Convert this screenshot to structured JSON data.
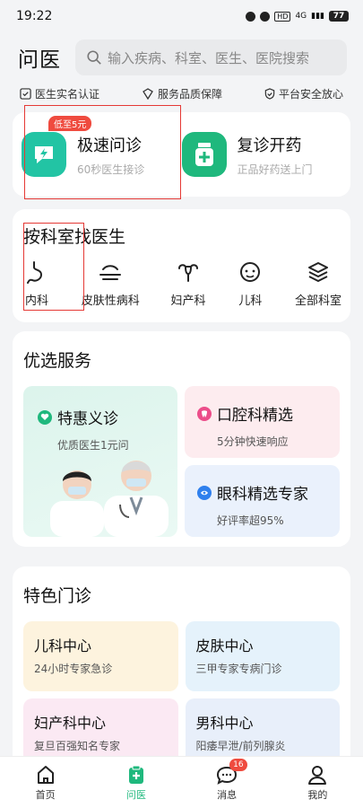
{
  "status_bar": {
    "time": "19:22",
    "network": "4G",
    "battery": "77"
  },
  "header": {
    "title": "问医",
    "search_placeholder": "输入疾病、科室、医生、医院搜索"
  },
  "badges": [
    "医生实名认证",
    "服务品质保障",
    "平台安全放心"
  ],
  "quick": [
    {
      "title": "极速问诊",
      "subtitle": "60秒医生接诊",
      "tag": "低至5元",
      "icon": "lightning-chat-icon",
      "color": "#22c4a4"
    },
    {
      "title": "复诊开药",
      "subtitle": "正品好药送上门",
      "icon": "medicine-bottle-icon",
      "color": "#1fb87d"
    }
  ],
  "departments": {
    "title": "按科室找医生",
    "items": [
      {
        "label": "内科",
        "icon": "stomach-icon"
      },
      {
        "label": "皮肤性病科",
        "icon": "skin-icon"
      },
      {
        "label": "妇产科",
        "icon": "uterus-icon"
      },
      {
        "label": "儿科",
        "icon": "baby-face-icon"
      },
      {
        "label": "全部科室",
        "icon": "layers-icon"
      }
    ]
  },
  "services": {
    "title": "优选服务",
    "big": {
      "title": "特惠义诊",
      "subtitle": "优质医生1元问",
      "icon": "heart-icon"
    },
    "small": [
      {
        "title": "口腔科精选",
        "subtitle": "5分钟快速响应",
        "icon": "tooth-icon",
        "color": "#ec4d8a"
      },
      {
        "title": "眼科精选专家",
        "subtitle": "好评率超95%",
        "icon": "eye-icon",
        "color": "#2f80ed"
      }
    ]
  },
  "special": {
    "title": "特色门诊",
    "items": [
      {
        "title": "儿科中心",
        "subtitle": "24小时专家急诊"
      },
      {
        "title": "皮肤中心",
        "subtitle": "三甲专家专病门诊"
      },
      {
        "title": "妇产科中心",
        "subtitle": "复旦百强知名专家"
      },
      {
        "title": "男科中心",
        "subtitle": "阳痿早泄/前列腺炎"
      }
    ]
  },
  "tabbar": {
    "items": [
      {
        "label": "首页",
        "icon": "home-icon"
      },
      {
        "label": "问医",
        "icon": "medical-clipboard-icon"
      },
      {
        "label": "消息",
        "icon": "chat-bubble-icon",
        "badge": "16"
      },
      {
        "label": "我的",
        "icon": "user-icon"
      }
    ],
    "active_color": "#1fb87d"
  }
}
